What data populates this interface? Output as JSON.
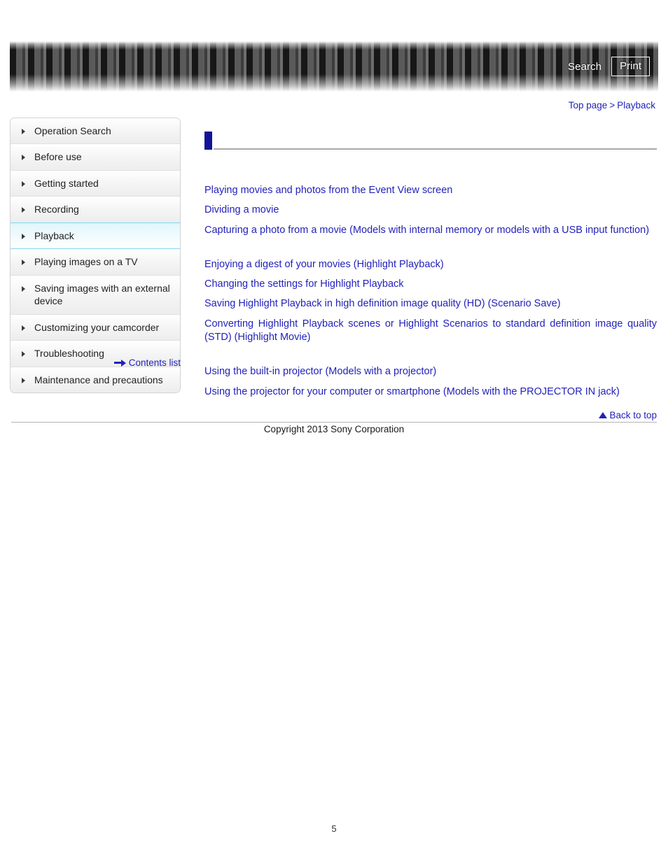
{
  "header": {
    "search_label": "Search",
    "print_label": "Print"
  },
  "breadcrumb": {
    "top_label": "Top page",
    "separator": ">",
    "current_label": "Playback"
  },
  "sidebar": {
    "items": [
      {
        "label": "Operation Search",
        "active": false
      },
      {
        "label": "Before use",
        "active": false
      },
      {
        "label": "Getting started",
        "active": false
      },
      {
        "label": "Recording",
        "active": false
      },
      {
        "label": "Playback",
        "active": true
      },
      {
        "label": "Playing images on a TV",
        "active": false
      },
      {
        "label": "Saving images with an external device",
        "active": false
      },
      {
        "label": "Customizing your camcorder",
        "active": false
      },
      {
        "label": "Troubleshooting",
        "active": false
      },
      {
        "label": "Maintenance and precautions",
        "active": false
      }
    ],
    "contents_list_label": "Contents list"
  },
  "main": {
    "heading": "",
    "groups": [
      {
        "links": [
          "Playing movies and photos from the Event View screen",
          "Dividing a movie",
          "Capturing a photo from a movie (Models with internal memory or models with a USB input function)"
        ]
      },
      {
        "links": [
          "Enjoying a digest of your movies (Highlight Playback)",
          "Changing the settings for Highlight Playback",
          "Saving Highlight Playback in high definition image quality (HD) (Scenario Save)",
          "Converting Highlight Playback scenes or Highlight Scenarios to standard definition image quality (STD) (Highlight Movie)"
        ]
      },
      {
        "links": [
          "Using the built-in projector (Models with a projector)",
          "Using the projector for your computer or smartphone (Models with the PROJECTOR IN jack)"
        ]
      }
    ]
  },
  "footer": {
    "back_to_top_label": "Back to top",
    "copyright": "Copyright 2013 Sony Corporation",
    "page_number": "5"
  },
  "colors": {
    "link": "#2222bb",
    "marker": "#131398",
    "active_nav": "#7fd8ea"
  }
}
